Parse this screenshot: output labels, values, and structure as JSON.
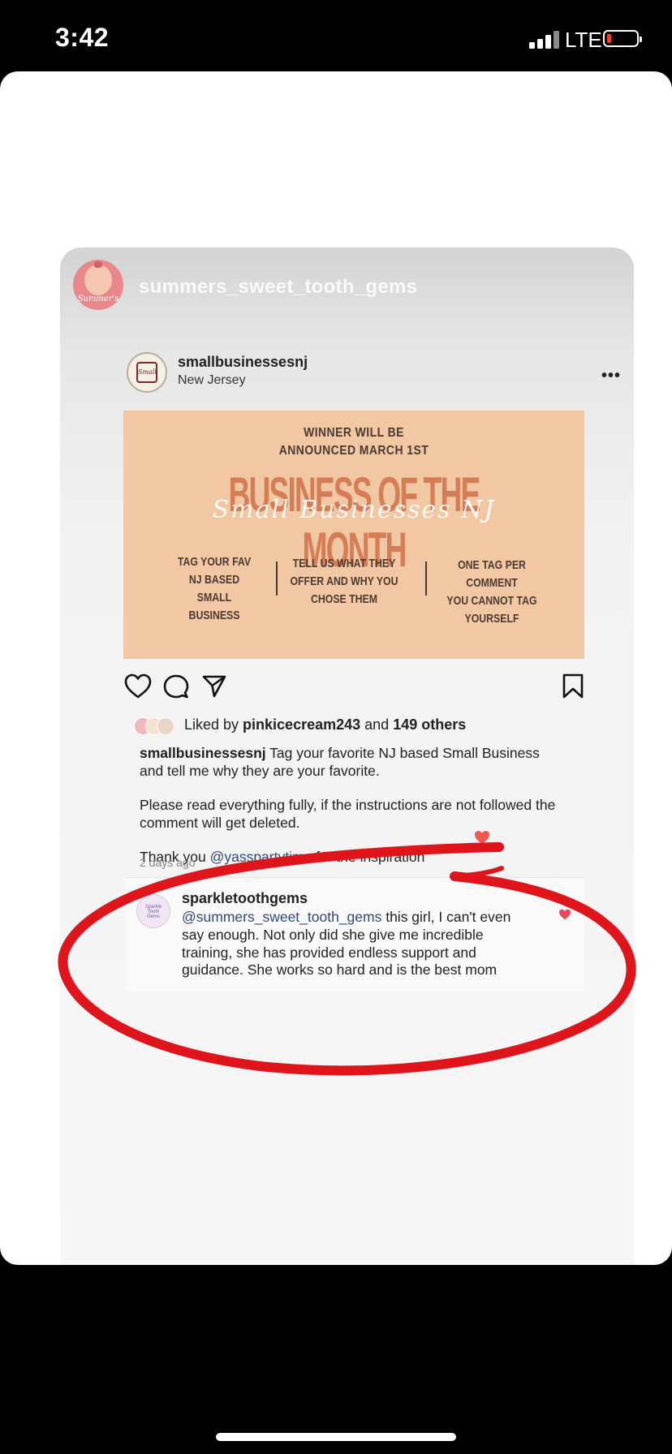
{
  "status_bar": {
    "time": "3:42",
    "network": "LTE"
  },
  "story": {
    "username": "summers_sweet_tooth_gems",
    "avatar_text": "Summer's"
  },
  "post": {
    "username": "smallbusinessesnj",
    "location": "New Jersey",
    "avatar_text": "Small",
    "more_label": "•••",
    "banner": {
      "announcement_line1": "WINNER WILL BE",
      "announcement_line2": "ANNOUNCED MARCH 1ST",
      "title": "BUSINESS OF THE MONTH",
      "script": "Small Businesses NJ",
      "rule1": [
        "TAG YOUR FAV",
        "NJ BASED",
        "SMALL",
        "BUSINESS"
      ],
      "rule2": [
        "TELL US WHAT THEY",
        "OFFER AND WHY YOU",
        "CHOSE THEM"
      ],
      "rule3": [
        "ONE TAG PER",
        "COMMENT",
        "YOU CANNOT TAG",
        "YOURSELF"
      ]
    },
    "likes": {
      "prefix": "Liked by ",
      "user": "pinkicecream243",
      "middle": " and ",
      "others": "149 others"
    },
    "caption": {
      "username": "smallbusinessesnj",
      "text": " Tag your favorite NJ based Small Business and tell me why they are your favorite.",
      "paragraph2": "Please read everything fully, if the instructions are not followed the comment will get deleted.",
      "thanks_prefix": "Thank you ",
      "thanks_mention": "@yasspartytime",
      "thanks_suffix": " for the inspiration"
    },
    "time_ago": "2 days ago"
  },
  "comment": {
    "username": "sparkletoothgems",
    "mention": "@summers_sweet_tooth_gems",
    "text": " this girl, I can't even say enough. Not only did she give me incredible training, she has provided endless support and guidance. She works so hard and is the best mom",
    "avatar_text": "Sparkle Tooth Gems"
  },
  "colors": {
    "banner_bg": "#f2c8a4",
    "title_orange": "#d57e55",
    "annotation_red": "#e0141b",
    "mention_blue": "#2f4a7a"
  },
  "icons": [
    "heart-icon",
    "comment-icon",
    "share-icon",
    "bookmark-icon",
    "more-icon",
    "heart-small-icon"
  ]
}
